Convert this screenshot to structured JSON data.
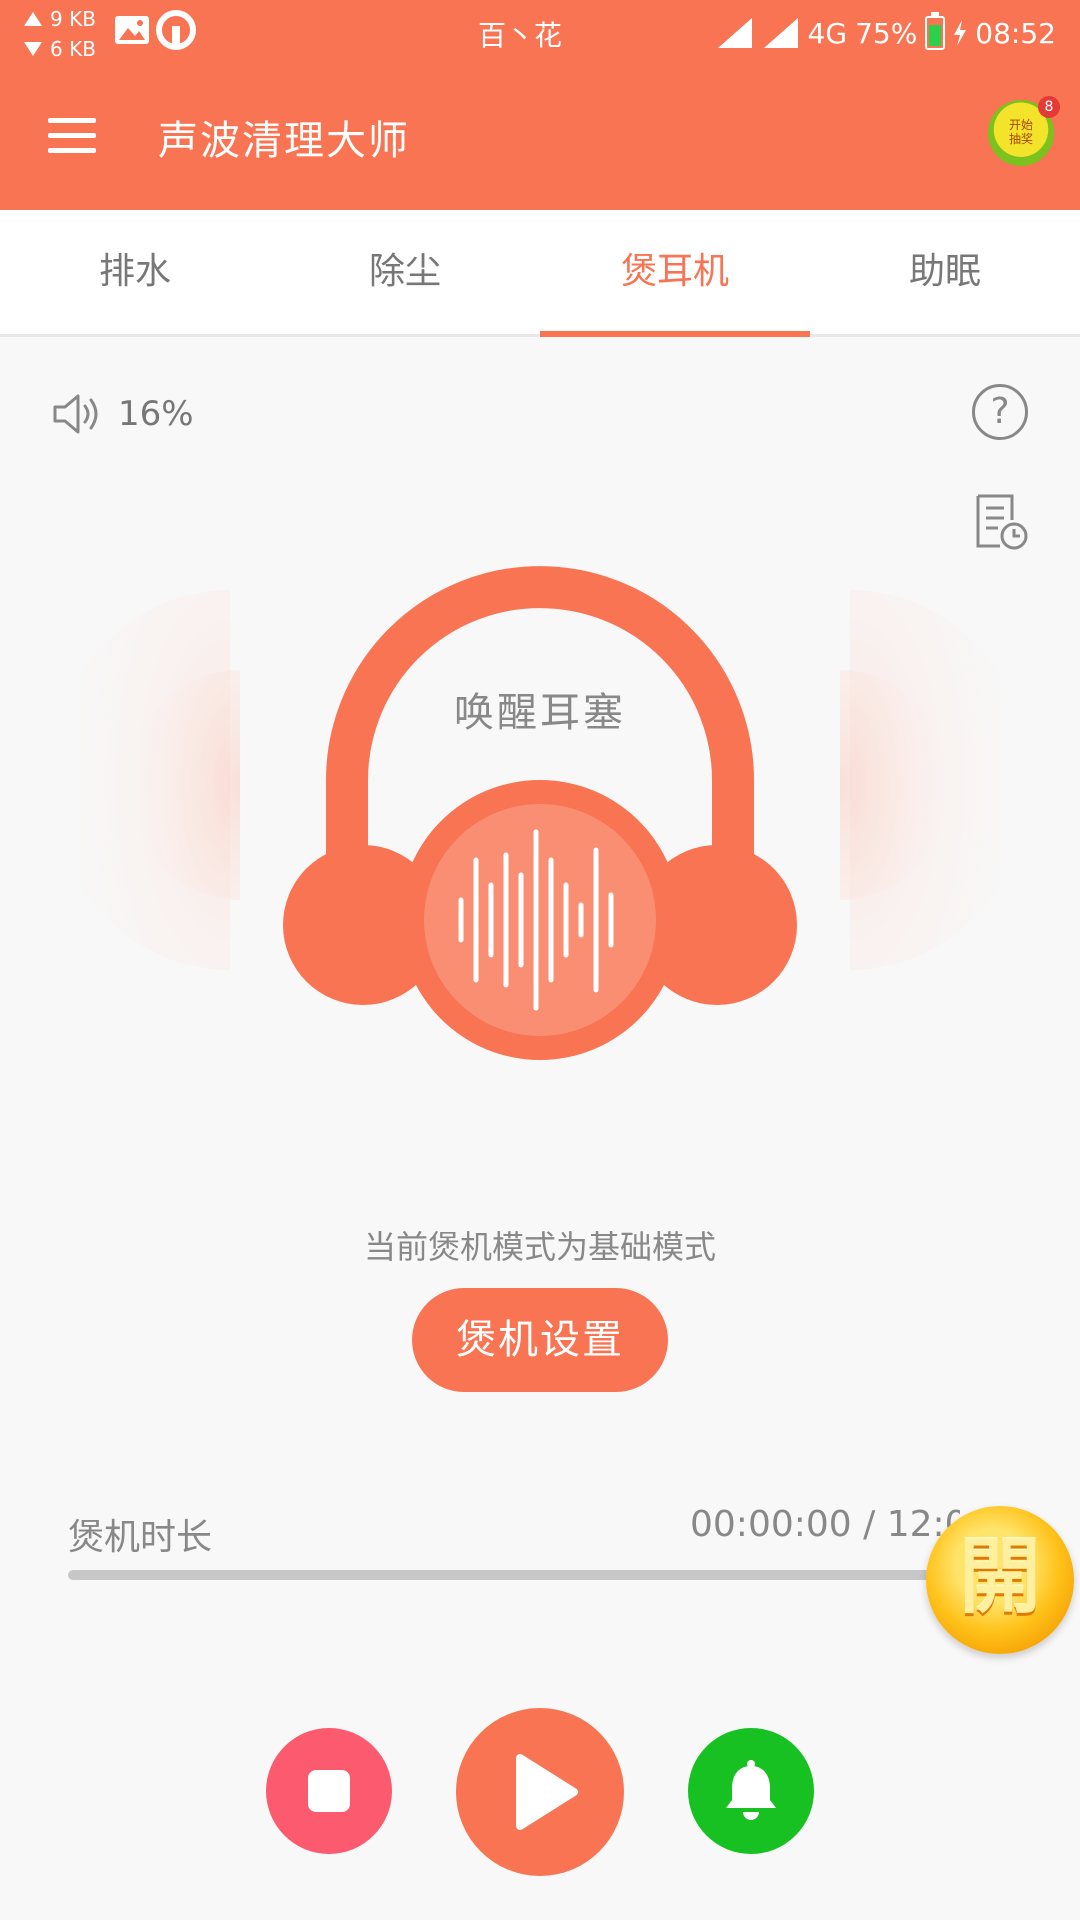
{
  "status_bar": {
    "net_up": "9 KB",
    "net_down": "6 KB",
    "carrier": "百丶花",
    "network": "4G",
    "battery": "75%",
    "time": "08:52",
    "icons": [
      "gallery-icon",
      "app-notify-icon",
      "signal-icon",
      "battery-icon",
      "charging-icon"
    ]
  },
  "app_bar": {
    "title": "声波清理大师",
    "lottery_label": "开始\n抽奖",
    "lottery_badge": "8"
  },
  "tabs": [
    {
      "label": "排水",
      "active": false
    },
    {
      "label": "除尘",
      "active": false
    },
    {
      "label": "煲耳机",
      "active": true
    },
    {
      "label": "助眠",
      "active": false
    }
  ],
  "volume": {
    "label": "16%"
  },
  "illustration": {
    "label": "唤醒耳塞"
  },
  "mode": {
    "text": "当前煲机模式为基础模式",
    "button": "煲机设置"
  },
  "duration": {
    "label": "煲机时长",
    "time": "00:00:00 / 12:00",
    "progress": 0
  },
  "floating_coin": {
    "label": "開"
  },
  "controls": [
    "stop",
    "play",
    "notify"
  ],
  "colors": {
    "accent": "#f87453",
    "stop": "#fb5a6f",
    "bell": "#17c122"
  }
}
